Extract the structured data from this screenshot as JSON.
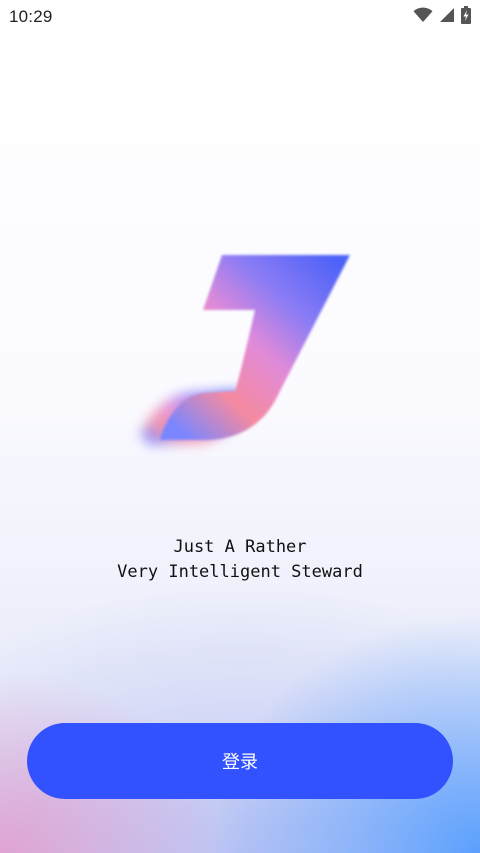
{
  "status_bar": {
    "time": "10:29",
    "icons": [
      "wifi-icon",
      "cellular-signal-icon",
      "battery-charging-icon"
    ]
  },
  "brand": {
    "logo": "j-logo",
    "tagline_line1": "Just A Rather",
    "tagline_line2": "Very Intelligent Steward"
  },
  "actions": {
    "login_label": "登录"
  },
  "colors": {
    "button_bg": "#3352ff",
    "button_text": "#ffffff"
  }
}
